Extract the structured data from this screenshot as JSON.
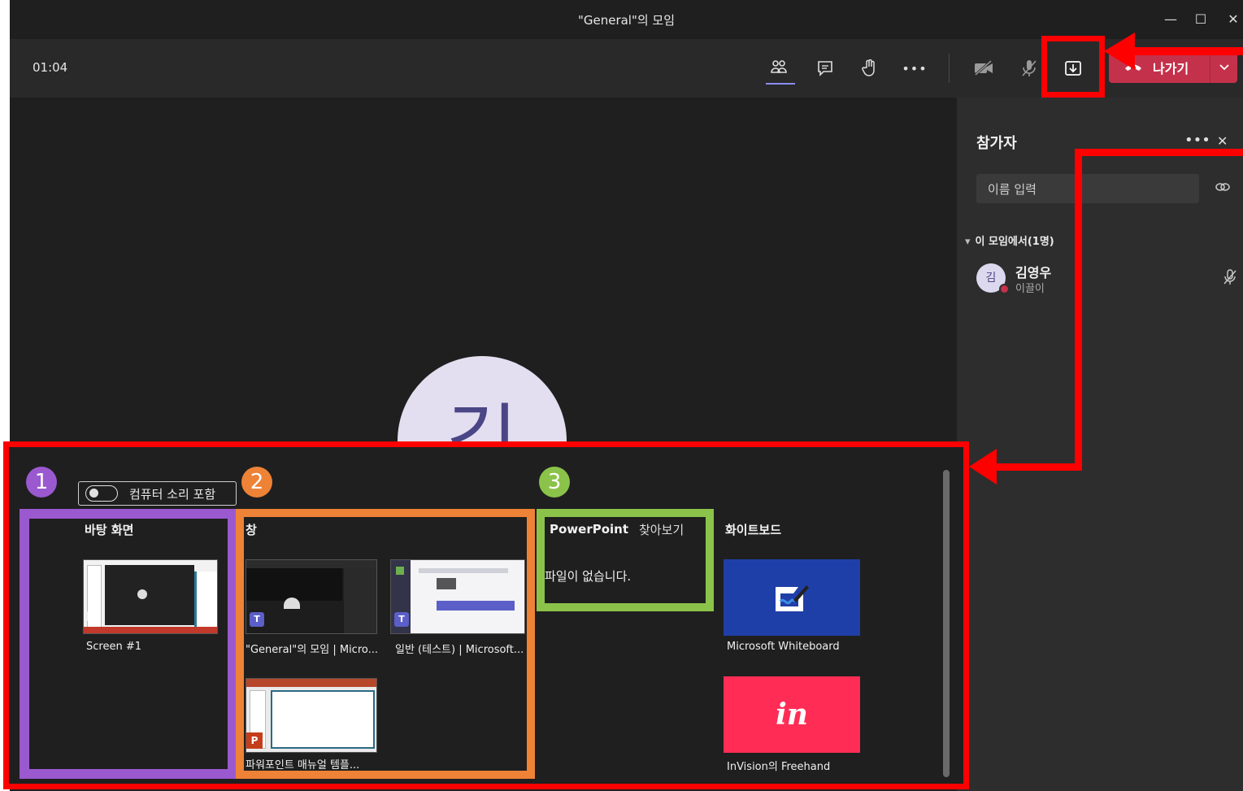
{
  "window": {
    "title": "\"General\"의 모임",
    "minimize_glyph": "—",
    "maximize_glyph": "☐",
    "close_glyph": "✕"
  },
  "toolbar": {
    "timer": "01:04",
    "more_glyph": "•••",
    "leave_label": "나가기",
    "leave_chevron": "⌄"
  },
  "stage": {
    "avatar_initial": "김"
  },
  "participants": {
    "title": "참가자",
    "more_glyph": "•••",
    "close_glyph": "✕",
    "search_placeholder": "이름 입력",
    "group_label": "이 모임에서(1명)",
    "group_chevron": "▾",
    "people": [
      {
        "initial": "김",
        "name": "김영우",
        "subtitle": "이끌이",
        "status_color": "#c4314b"
      }
    ]
  },
  "share": {
    "include_audio_label": "컴퓨터 소리 포함",
    "desktop": {
      "title": "바탕 화면",
      "screens": [
        "Screen #1"
      ]
    },
    "windows": {
      "title": "창",
      "items": [
        "\"General\"의 모임 | Micro...",
        "일반 (테스트) | Microsoft...",
        "파워포인트 매뉴얼 템플..."
      ]
    },
    "powerpoint": {
      "title": "PowerPoint",
      "browse_label": "찾아보기",
      "empty_text": "파일이 없습니다."
    },
    "whiteboard": {
      "title": "화이트보드",
      "items": [
        {
          "name": "Microsoft Whiteboard",
          "color": "#1f3fa8"
        },
        {
          "name": "InVision의 Freehand",
          "color": "#ff2d55",
          "logo": "in"
        }
      ]
    }
  },
  "annotations": {
    "markers": [
      {
        "label": "1",
        "color": "#9b59d0"
      },
      {
        "label": "2",
        "color": "#ee8236"
      },
      {
        "label": "3",
        "color": "#8bc34a"
      }
    ],
    "highlight_color": "#ff0000"
  }
}
